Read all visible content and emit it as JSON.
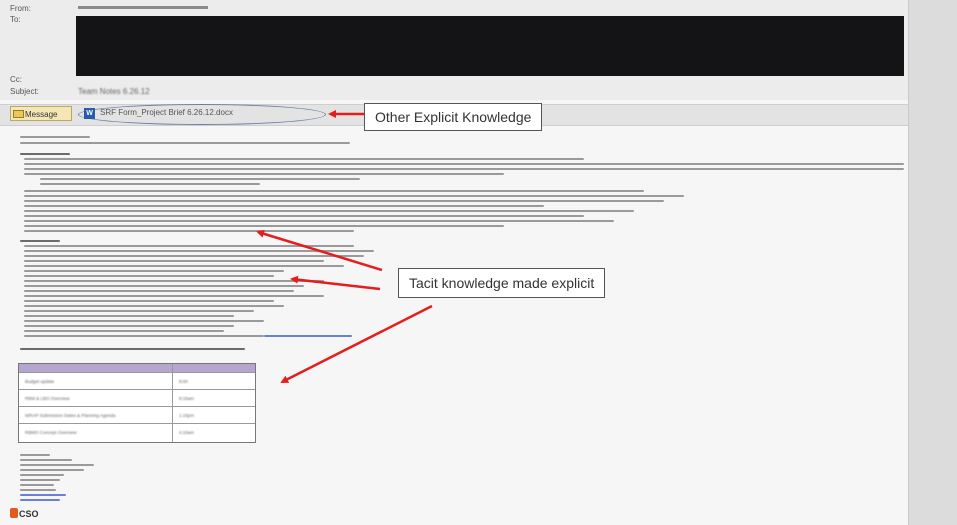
{
  "header": {
    "from_label": "From:",
    "to_label": "To:",
    "cc_label": "Cc:",
    "subject_label": "Subject:",
    "subject_value": "Team Notes 6.26.12"
  },
  "attachments": {
    "message_tab": "Message",
    "file_name": "SRF Form_Project Brief 6.26.12.docx"
  },
  "callouts": {
    "explicit": "Other Explicit Knowledge",
    "tacit": "Tacit knowledge made explicit"
  },
  "table": {
    "rows": [
      {
        "item": "Budget update",
        "time": "8:00"
      },
      {
        "item": "RBM & LBO Overview",
        "time": "8:15am"
      },
      {
        "item": "WRAP Submission Dates & Planning Agenda",
        "time": "1:15pm"
      },
      {
        "item": "RBMO Concept Overview",
        "time": "4:15am"
      }
    ]
  },
  "signature": {
    "logo_text": "CSO"
  },
  "colors": {
    "arrow": "#e41e1e",
    "redaction": "#141416",
    "table_header": "#b6a6cf"
  }
}
